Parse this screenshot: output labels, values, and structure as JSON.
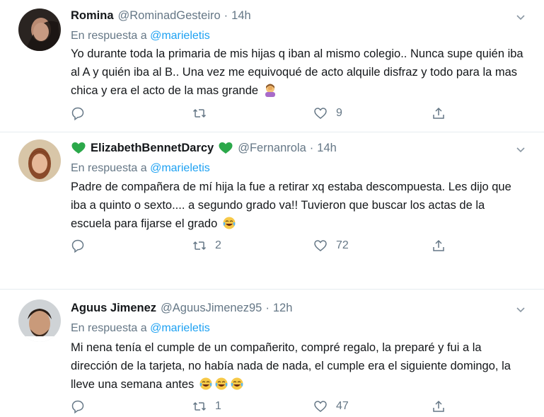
{
  "tweets": [
    {
      "name": "Romina",
      "handle": "@RominadGesteiro",
      "dot": "·",
      "time": "14h",
      "reply_prefix": "En respuesta a",
      "reply_mention": "@marieletis",
      "text": "Yo durante toda la primaria de mis hijas q iban al mismo colegio.. Nunca supe quién iba al A y quién iba al B.. Una vez me equivoqué de acto alquile disfraz y todo para la mas chica y era el acto de la mas grande",
      "text_emojis": [
        "woman-facepalming-emoji"
      ],
      "retweets": "",
      "likes": "9"
    },
    {
      "name": "ElizabethBennetDarcy",
      "handle": "@Fernanrola",
      "dot": "·",
      "time": "14h",
      "name_emojis": [
        "green-heart-emoji",
        "green-heart-emoji"
      ],
      "reply_prefix": "En respuesta a",
      "reply_mention": "@marieletis",
      "text": "Padre de compañera de mí hija la fue a retirar xq estaba descompuesta. Les dijo que iba a quinto o sexto.... a segundo grado va!! Tuvieron que buscar los actas de la escuela para fijarse el grado",
      "text_emojis": [
        "tears-of-joy-emoji"
      ],
      "retweets": "2",
      "likes": "72"
    },
    {
      "name": "Aguus Jimenez",
      "handle": "@AguusJimenez95",
      "dot": "·",
      "time": "12h",
      "reply_prefix": "En respuesta a",
      "reply_mention": "@marieletis",
      "text": "Mi nena tenía el cumple de un compañerito, compré regalo, la preparé y fui a la dirección de la tarjeta, no había nada de nada, el cumple era el siguiente domingo, la lleve una semana antes",
      "text_emojis": [
        "tears-of-joy-emoji",
        "tears-of-joy-emoji",
        "tears-of-joy-emoji"
      ],
      "retweets": "1",
      "likes": "47"
    }
  ],
  "colors": {
    "text": "#14171a",
    "muted": "#657786",
    "link": "#1da1f2",
    "green_heart": "#2ba84a",
    "separator": "#e6ecf0"
  }
}
